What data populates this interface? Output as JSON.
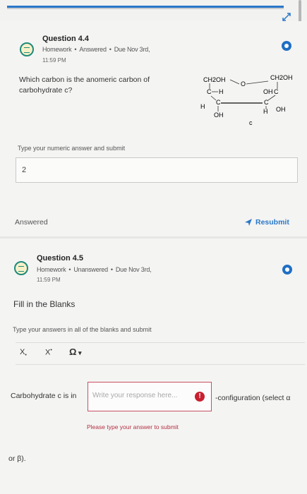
{
  "q1": {
    "title": "Question 4.4",
    "type": "Homework",
    "status": "Answered",
    "due": "Due Nov 3rd,",
    "due_time": "11:59 PM",
    "prompt_line1": "Which carbon is the anomeric carbon of",
    "prompt_line2": "carbohydrate c?",
    "instruction": "Type your numeric answer and submit",
    "answer_value": "2",
    "answered_label": "Answered",
    "resubmit_label": "Resubmit",
    "structure": {
      "c6": "CH2OH",
      "c1": "CH2OH",
      "c5": "C",
      "c4": "C",
      "c3": "C",
      "c2": "C",
      "h_left": "H",
      "h_right_top": "H",
      "h_right_bottom": "H",
      "oh_left": "OH",
      "oh_right": "OH",
      "oh_top": "OH",
      "ring_o": "O",
      "caption": "c"
    }
  },
  "q2": {
    "title": "Question 4.5",
    "type": "Homework",
    "status": "Unanswered",
    "due": "Due Nov 3rd,",
    "due_time": "11:59 PM",
    "prompt": "Fill in the Blanks",
    "instruction": "Type your answers in all of the blanks and submit",
    "toolbar": {
      "subscript": "X",
      "superscript": "X",
      "omega": "Ω"
    },
    "blank_prefix": "Carbohydrate c is in",
    "blank_placeholder": "Write your response here...",
    "blank_suffix": "-configuration (select α",
    "blank_suffix2": "or β).",
    "error_message": "Please type your answer to submit"
  }
}
